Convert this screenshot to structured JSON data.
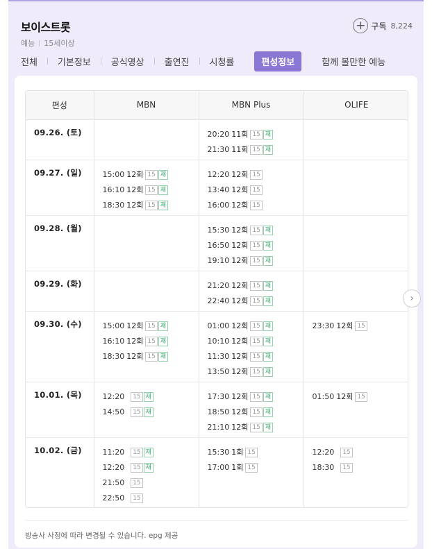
{
  "header": {
    "title": "보이스트롯",
    "genre": "예능",
    "age": "15세이상",
    "subscribe_label": "구독",
    "subscribe_count": "8,224"
  },
  "tabs": [
    {
      "label": "전체",
      "active": false
    },
    {
      "label": "기본정보",
      "active": false
    },
    {
      "label": "공식영상",
      "active": false
    },
    {
      "label": "출연진",
      "active": false
    },
    {
      "label": "시청률",
      "active": false
    },
    {
      "label": "편성정보",
      "active": true
    },
    {
      "label": "함께 볼만한 예능",
      "active": false
    }
  ],
  "schedule": {
    "headers": [
      "편성",
      "MBN",
      "MBN Plus",
      "OLIFE"
    ],
    "rows": [
      {
        "date": "09.26. (토)",
        "channels": [
          [],
          [
            {
              "time": "20:20",
              "ep": "11회",
              "rating": "15",
              "rerun": "재"
            },
            {
              "time": "21:30",
              "ep": "11회",
              "rating": "15",
              "rerun": "재"
            }
          ],
          []
        ]
      },
      {
        "date": "09.27. (일)",
        "channels": [
          [
            {
              "time": "15:00",
              "ep": "12회",
              "rating": "15",
              "rerun": "재"
            },
            {
              "time": "16:10",
              "ep": "12회",
              "rating": "15",
              "rerun": "재"
            },
            {
              "time": "18:30",
              "ep": "12회",
              "rating": "15",
              "rerun": "재"
            }
          ],
          [
            {
              "time": "12:20",
              "ep": "12회",
              "rating": "15",
              "rerun": ""
            },
            {
              "time": "13:40",
              "ep": "12회",
              "rating": "15",
              "rerun": ""
            },
            {
              "time": "16:00",
              "ep": "12회",
              "rating": "15",
              "rerun": ""
            }
          ],
          []
        ]
      },
      {
        "date": "09.28. (월)",
        "channels": [
          [],
          [
            {
              "time": "15:30",
              "ep": "12회",
              "rating": "15",
              "rerun": "재"
            },
            {
              "time": "16:50",
              "ep": "12회",
              "rating": "15",
              "rerun": "재"
            },
            {
              "time": "19:10",
              "ep": "12회",
              "rating": "15",
              "rerun": "재"
            }
          ],
          []
        ]
      },
      {
        "date": "09.29. (화)",
        "channels": [
          [],
          [
            {
              "time": "21:20",
              "ep": "12회",
              "rating": "15",
              "rerun": "재"
            },
            {
              "time": "22:40",
              "ep": "12회",
              "rating": "15",
              "rerun": "재"
            }
          ],
          []
        ]
      },
      {
        "date": "09.30. (수)",
        "channels": [
          [
            {
              "time": "15:00",
              "ep": "12회",
              "rating": "15",
              "rerun": "재"
            },
            {
              "time": "16:10",
              "ep": "12회",
              "rating": "15",
              "rerun": "재"
            },
            {
              "time": "18:30",
              "ep": "12회",
              "rating": "15",
              "rerun": "재"
            }
          ],
          [
            {
              "time": "01:00",
              "ep": "12회",
              "rating": "15",
              "rerun": "재"
            },
            {
              "time": "10:10",
              "ep": "12회",
              "rating": "15",
              "rerun": "재"
            },
            {
              "time": "11:30",
              "ep": "12회",
              "rating": "15",
              "rerun": "재"
            },
            {
              "time": "13:50",
              "ep": "12회",
              "rating": "15",
              "rerun": "재"
            }
          ],
          [
            {
              "time": "23:30",
              "ep": "12회",
              "rating": "15",
              "rerun": ""
            }
          ]
        ]
      },
      {
        "date": "10.01. (목)",
        "channels": [
          [
            {
              "time": "12:20",
              "ep": "",
              "rating": "15",
              "rerun": "재"
            },
            {
              "time": "14:50",
              "ep": "",
              "rating": "15",
              "rerun": "재"
            }
          ],
          [
            {
              "time": "17:30",
              "ep": "12회",
              "rating": "15",
              "rerun": "재"
            },
            {
              "time": "18:50",
              "ep": "12회",
              "rating": "15",
              "rerun": "재"
            },
            {
              "time": "21:10",
              "ep": "12회",
              "rating": "15",
              "rerun": "재"
            }
          ],
          [
            {
              "time": "01:50",
              "ep": "12회",
              "rating": "15",
              "rerun": ""
            }
          ]
        ]
      },
      {
        "date": "10.02. (금)",
        "channels": [
          [
            {
              "time": "11:20",
              "ep": "",
              "rating": "15",
              "rerun": "재"
            },
            {
              "time": "12:20",
              "ep": "",
              "rating": "15",
              "rerun": "재"
            },
            {
              "time": "21:50",
              "ep": "",
              "rating": "15",
              "rerun": ""
            },
            {
              "time": "22:50",
              "ep": "",
              "rating": "15",
              "rerun": ""
            }
          ],
          [
            {
              "time": "15:30",
              "ep": "1회",
              "rating": "15",
              "rerun": ""
            },
            {
              "time": "17:00",
              "ep": "1회",
              "rating": "15",
              "rerun": ""
            }
          ],
          [
            {
              "time": "12:20",
              "ep": "",
              "rating": "15",
              "rerun": ""
            },
            {
              "time": "18:30",
              "ep": "",
              "rating": "15",
              "rerun": ""
            }
          ]
        ]
      }
    ]
  },
  "footer": {
    "note": "방송사 사정에 따라 변경될 수 있습니다. epg 제공"
  },
  "icons": {
    "subscribe": "plus-icon",
    "next": "chevron-right-icon"
  },
  "colors": {
    "accent": "#8a77d3",
    "panel_bg": "#efebfb",
    "rerun": "#33a66b"
  }
}
